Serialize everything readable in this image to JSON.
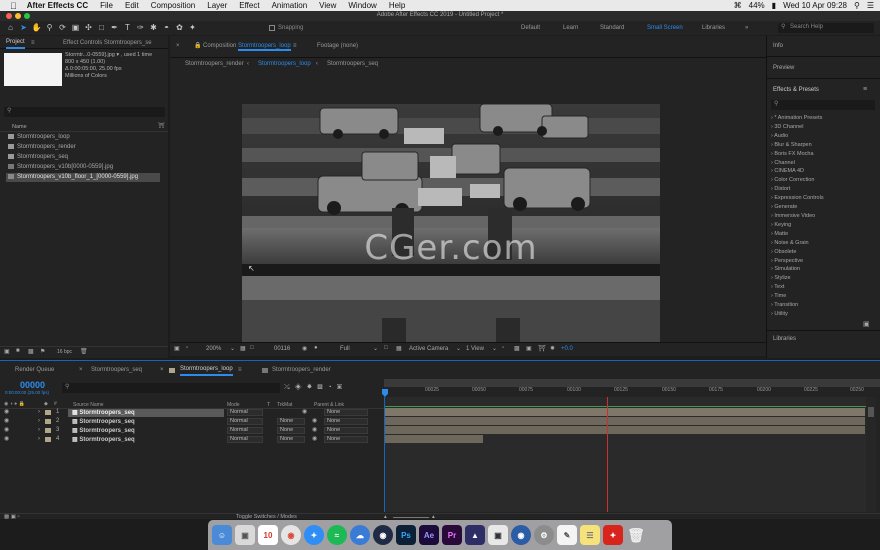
{
  "menubar": {
    "app_name": "After Effects CC",
    "items": [
      "File",
      "Edit",
      "Composition",
      "Layer",
      "Effect",
      "Animation",
      "View",
      "Window",
      "Help"
    ],
    "battery": "44%",
    "clock": "Wed 10 Apr 09:28"
  },
  "window_title": "Adobe After Effects CC 2019 - Untitled Project *",
  "toolbar": {
    "snapping_label": "Snapping",
    "workspaces": [
      "Default",
      "Learn",
      "Standard",
      "Small Screen",
      "Libraries"
    ],
    "active_workspace": "Small Screen",
    "search_placeholder": "Search Help"
  },
  "project_panel": {
    "tab_project": "Project",
    "tab_effect_controls": "Effect Controls Stormtroopers_se",
    "selected_name": "Stormtr...0-0559].jpg ▾ , used 1 time",
    "selected_dims": "800 x 450 (1.00)",
    "selected_duration": "Δ 0:00:05:00, 25.00 fps",
    "selected_colors": "Millions of Colors",
    "column_name": "Name",
    "items": [
      {
        "name": "Stormtroopers_loop",
        "type": "comp"
      },
      {
        "name": "Stormtroopers_render",
        "type": "comp"
      },
      {
        "name": "Stormtroopers_seq",
        "type": "comp"
      },
      {
        "name": "Stormtroopers_v10b[0000-0559].jpg",
        "type": "footage"
      },
      {
        "name": "Stormtroopers_v10b_floor_1_[0000-0559].jpg",
        "type": "footage",
        "selected": true
      }
    ],
    "bpc": "16 bpc"
  },
  "composition_panel": {
    "tab_composition": "Composition",
    "tab_comp_name": "Stormtroopers_loop",
    "tab_footage": "Footage (none)",
    "breadcrumbs": [
      "Stormtroopers_render",
      "Stormtroopers_loop",
      "Stormtroopers_seq"
    ],
    "active_breadcrumb": "Stormtroopers_loop",
    "watermark": "CGer.com",
    "zoom": "200%",
    "timecode": "00116",
    "resolution": "Full",
    "camera": "Active Camera",
    "views": "1 View",
    "exposure": "+0.0"
  },
  "right_panel": {
    "info": "Info",
    "preview": "Preview",
    "effects_title": "Effects & Presets",
    "effects": [
      "* Animation Presets",
      "3D Channel",
      "Audio",
      "Blur & Sharpen",
      "Boris FX Mocha",
      "Channel",
      "CINEMA 4D",
      "Color Correction",
      "Distort",
      "Expression Controls",
      "Generate",
      "Immersive Video",
      "Keying",
      "Matte",
      "Noise & Grain",
      "Obsolete",
      "Perspective",
      "Simulation",
      "Stylize",
      "Text",
      "Time",
      "Transition",
      "Utility"
    ],
    "libraries": "Libraries"
  },
  "timeline": {
    "tabs": [
      "Render Queue",
      "Stormtroopers_seq",
      "Stormtroopers_loop",
      "Stormtroopers_render"
    ],
    "active_tab": "Stormtroopers_loop",
    "current_time": "00000",
    "current_time_sub": "0:00:00:00 (25.00 fps)",
    "col_source": "Source Name",
    "col_mode": "Mode",
    "col_t": "T",
    "col_trkmat": "TrkMat",
    "col_parent": "Parent & Link",
    "ruler": [
      "00025",
      "00050",
      "00075",
      "00100",
      "00125",
      "00150",
      "00175",
      "00200",
      "00225",
      "00250"
    ],
    "layers": [
      {
        "num": "1",
        "name": "Stormtroopers_seq",
        "mode": "Normal",
        "trkmat": "",
        "parent": "None",
        "selected": true
      },
      {
        "num": "2",
        "name": "Stormtroopers_seq",
        "mode": "Normal",
        "trkmat": "None",
        "parent": "None"
      },
      {
        "num": "3",
        "name": "Stormtroopers_seq",
        "mode": "Normal",
        "trkmat": "None",
        "parent": "None"
      },
      {
        "num": "4",
        "name": "Stormtroopers_seq",
        "mode": "Normal",
        "trkmat": "None",
        "parent": "None"
      }
    ],
    "toggle_label": "Toggle Switches / Modes"
  },
  "dock": {
    "apps": [
      "Finder",
      "Preview",
      "Calendar",
      "Chrome",
      "Safari",
      "Spotify",
      "Cinema4D",
      "Ps",
      "Ae",
      "Pr",
      "Mocha",
      "Media",
      "Blender",
      "System",
      "TextEdit",
      "Notes",
      "Acrobat",
      "Trash"
    ],
    "calendar_day": "10"
  }
}
